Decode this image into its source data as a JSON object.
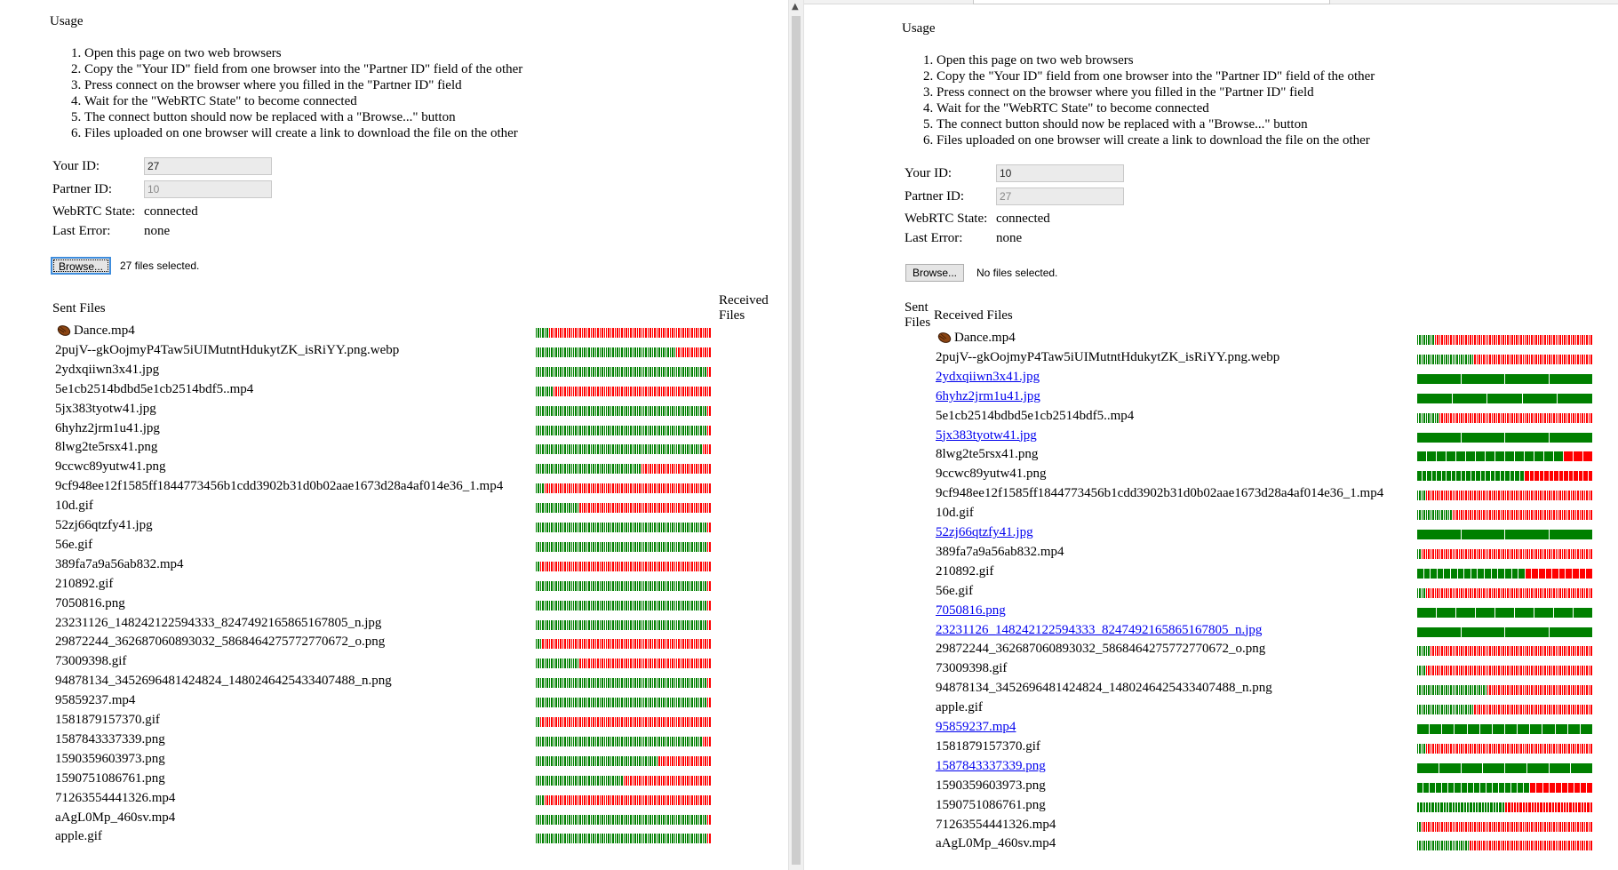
{
  "usage_title": "Usage",
  "usage_steps": [
    "Open this page on two web browsers",
    "Copy the \"Your ID\" field from one browser into the \"Partner ID\" field of the other",
    "Press connect on the browser where you filled in the \"Partner ID\" field",
    "Wait for the \"WebRTC State\" to become connected",
    "The connect button should now be replaced with a \"Browse...\" button",
    "Files uploaded on one browser will create a link to download the file on the other"
  ],
  "labels": {
    "your_id": "Your ID:",
    "partner_id": "Partner ID:",
    "webrtc_state": "WebRTC State:",
    "last_error": "Last Error:",
    "sent_files": "Sent Files",
    "sent": "Sent",
    "files": "Files",
    "received": "Received",
    "received_files": "Received Files",
    "browse": "Browse..."
  },
  "colors": {
    "done": "#008000",
    "pending": "#ff0000",
    "link": "#0000ee"
  },
  "icons": {
    "first_file": "acorn-icon"
  },
  "files": [
    "Dance.mp4",
    "2pujV--gkOojmyP4Taw5iUIMutntHdukytZK_isRiYY.png.webp",
    "2ydxqiiwn3x41.jpg",
    "5e1cb2514bdbd5e1cb2514bdf5..mp4",
    "5jx383tyotw41.jpg",
    "6hyhz2jrm1u41.jpg",
    "8lwg2te5rsx41.png",
    "9ccwc89yutw41.png",
    "9cf948ee12f1585ff1844773456b1cdd3902b31d0b02aae1673d28a4af014e36_1.mp4",
    "10d.gif",
    "52zj66qtzfy41.jpg",
    "56e.gif",
    "389fa7a9a56ab832.mp4",
    "210892.gif",
    "7050816.png",
    "23231126_148242122594333_8247492165865167805_n.jpg",
    "29872244_362687060893032_5868464275772770672_o.png",
    "73009398.gif",
    "94878134_3452696481424824_1480246425433407488_n.png",
    "95859237.mp4",
    "1581879157370.gif",
    "1587843337339.png",
    "1590359603973.png",
    "1590751086761.png",
    "71263554441326.mp4",
    "aAgL0Mp_460sv.mp4",
    "apple.gif"
  ],
  "left": {
    "your_id": "27",
    "partner_id": "10",
    "state": "connected",
    "last_error": "none",
    "selection": "27 files selected.",
    "sent_progress": [
      0.08,
      0.8,
      0.98,
      0.1,
      0.97,
      0.98,
      0.95,
      0.6,
      0.05,
      0.25,
      0.97,
      0.97,
      0.02,
      0.97,
      0.98,
      0.97,
      0.04,
      0.25,
      0.97,
      0.97,
      0.02,
      0.95,
      0.7,
      0.5,
      0.05,
      0.97,
      0.97
    ]
  },
  "right": {
    "your_id": "10",
    "partner_id": "27",
    "state": "connected",
    "last_error": "none",
    "selection": "No files selected.",
    "received": [
      {
        "name": "Dance.mp4",
        "link": false,
        "segments": 80,
        "progress": 0.1
      },
      {
        "name": "2pujV--gkOojmyP4Taw5iUIMutntHdukytZK_isRiYY.png.webp",
        "link": false,
        "segments": 80,
        "progress": 0.32
      },
      {
        "name": "2ydxqiiwn3x41.jpg",
        "link": true,
        "segments": 4,
        "progress": 1
      },
      {
        "name": "6hyhz2jrm1u41.jpg",
        "link": true,
        "segments": 5,
        "progress": 1
      },
      {
        "name": "5e1cb2514bdbd5e1cb2514bdf5..mp4",
        "link": false,
        "segments": 80,
        "progress": 0.12
      },
      {
        "name": "5jx383tyotw41.jpg",
        "link": true,
        "segments": 4,
        "progress": 1
      },
      {
        "name": "8lwg2te5rsx41.png",
        "link": false,
        "segments": 18,
        "progress": 0.86
      },
      {
        "name": "9ccwc89yutw41.png",
        "link": false,
        "segments": 36,
        "progress": 0.6
      },
      {
        "name": "9cf948ee12f1585ff1844773456b1cdd3902b31d0b02aae1673d28a4af014e36_1.mp4",
        "link": false,
        "segments": 80,
        "progress": 0.05
      },
      {
        "name": "10d.gif",
        "link": false,
        "segments": 80,
        "progress": 0.2
      },
      {
        "name": "52zj66qtzfy41.jpg",
        "link": true,
        "segments": 4,
        "progress": 1
      },
      {
        "name": "389fa7a9a56ab832.mp4",
        "link": false,
        "segments": 80,
        "progress": 0.03
      },
      {
        "name": "210892.gif",
        "link": false,
        "segments": 26,
        "progress": 0.6
      },
      {
        "name": "56e.gif",
        "link": false,
        "segments": 80,
        "progress": 0.05
      },
      {
        "name": "7050816.png",
        "link": true,
        "segments": 9,
        "progress": 1
      },
      {
        "name": "23231126_148242122594333_8247492165865167805_n.jpg",
        "link": true,
        "segments": 4,
        "progress": 1
      },
      {
        "name": "29872244_362687060893032_5868464275772770672_o.png",
        "link": false,
        "segments": 80,
        "progress": 0.08
      },
      {
        "name": "73009398.gif",
        "link": false,
        "segments": 80,
        "progress": 0.05
      },
      {
        "name": "94878134_3452696481424824_1480246425433407488_n.png",
        "link": false,
        "segments": 80,
        "progress": 0.4
      },
      {
        "name": "apple.gif",
        "link": false,
        "segments": 80,
        "progress": 0.33
      },
      {
        "name": "95859237.mp4",
        "link": true,
        "segments": 14,
        "progress": 1
      },
      {
        "name": "1581879157370.gif",
        "link": false,
        "segments": 80,
        "progress": 0.05
      },
      {
        "name": "1587843337339.png",
        "link": true,
        "segments": 8,
        "progress": 1
      },
      {
        "name": "1590359603973.png",
        "link": false,
        "segments": 28,
        "progress": 0.66
      },
      {
        "name": "1590751086761.png",
        "link": false,
        "segments": 60,
        "progress": 0.5
      },
      {
        "name": "71263554441326.mp4",
        "link": false,
        "segments": 80,
        "progress": 0.03
      },
      {
        "name": "aAgL0Mp_460sv.mp4",
        "link": false,
        "segments": 80,
        "progress": 0.3
      }
    ]
  }
}
